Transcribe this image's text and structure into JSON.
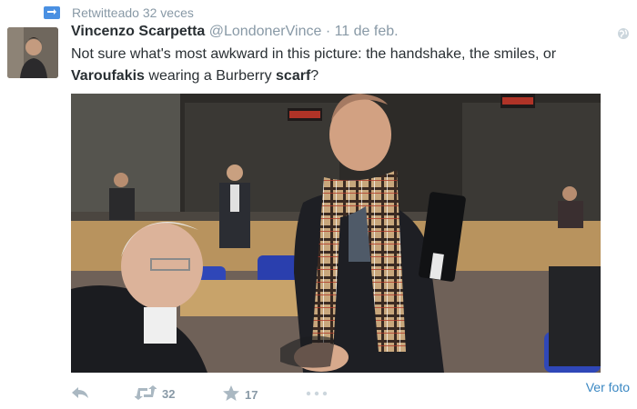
{
  "retweet": {
    "label": "Retwitteado 32 veces",
    "icon": "retweet-badge-icon"
  },
  "tweet": {
    "author_name": "Vincenzo Scarpetta",
    "handle": "@LondonerVince",
    "separator": "·",
    "date": "11 de feb.",
    "text_part1": "Not sure what's most awkward in this picture: the handshake, the smiles, or",
    "text_bold1": "Varoufakis",
    "text_part2": "wearing a Burberry",
    "text_bold2": "scarf",
    "text_part3": "?"
  },
  "actions": {
    "reply_icon": "reply-icon",
    "retweet_count": "32",
    "favorite_count": "17",
    "more_icon": "more-dots-icon",
    "view_photo": "Ver foto"
  },
  "colors": {
    "muted": "#8899a6",
    "link": "#3b88c3",
    "text": "#292f33",
    "badge": "#4a90e2"
  }
}
